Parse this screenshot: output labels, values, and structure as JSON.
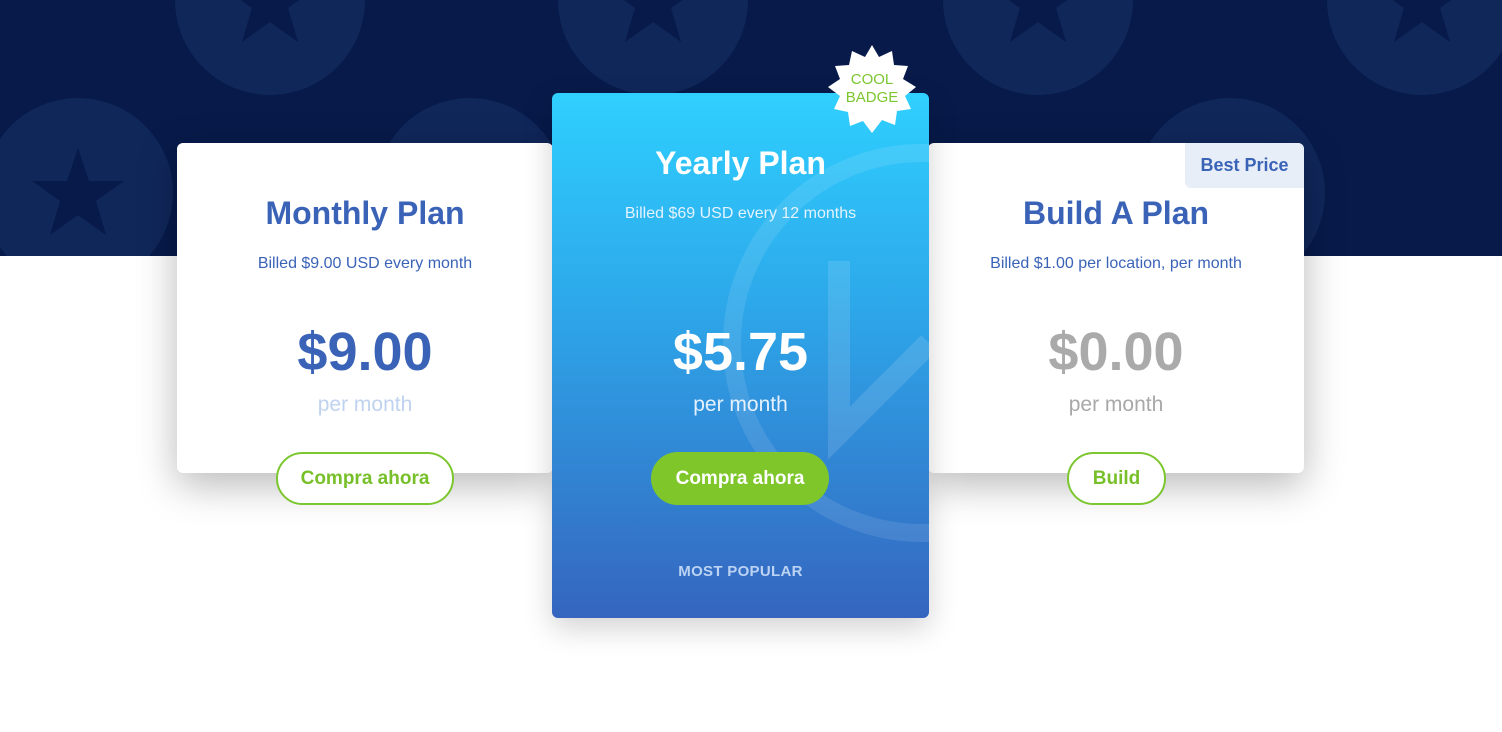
{
  "colors": {
    "hero_background": "#071a4a",
    "primary_blue": "#3a63b8",
    "accent_green": "#7cc62f",
    "featured_gradient_top": "#2fd0ff",
    "featured_gradient_bottom": "#3565bf"
  },
  "plans": {
    "monthly": {
      "title": "Monthly Plan",
      "billing": "Billed $9.00 USD every month",
      "price": "$9.00",
      "period": "per month",
      "button": "Compra ahora"
    },
    "yearly": {
      "badge": [
        "COOL",
        "BADGE"
      ],
      "title": "Yearly Plan",
      "billing": "Billed $69 USD every 12 months",
      "price": "$5.75",
      "period": "per month",
      "button": "Compra ahora",
      "footer": "MOST POPULAR"
    },
    "build": {
      "tag": "Best Price",
      "title": "Build A Plan",
      "billing": "Billed $1.00 per location, per month",
      "price": "$0.00",
      "period": "per month",
      "button": "Build"
    }
  }
}
